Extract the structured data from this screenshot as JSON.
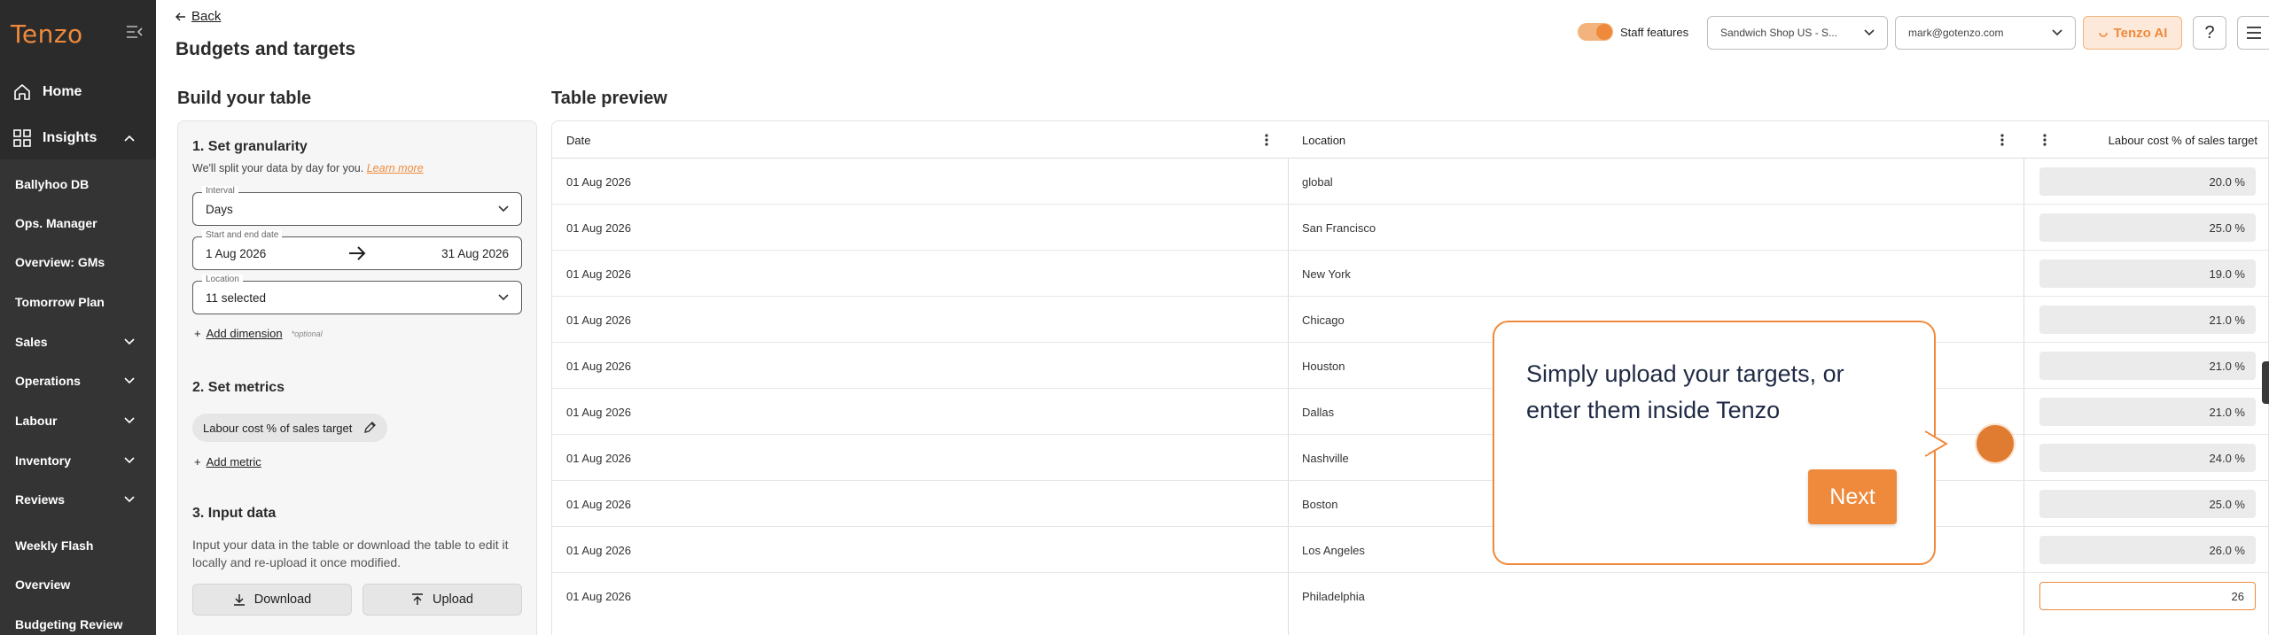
{
  "brand": {
    "logo_text": "Tenzo",
    "accent": "#ef8a3c",
    "sidebar_bg": "#2b2b2b"
  },
  "sidebar": {
    "home": "Home",
    "insights": "Insights",
    "items": [
      {
        "label": "Ballyhoo DB",
        "chevron": false
      },
      {
        "label": "Ops. Manager",
        "chevron": false
      },
      {
        "label": "Overview: GMs",
        "chevron": false
      },
      {
        "label": "Tomorrow Plan",
        "chevron": false
      },
      {
        "label": "Sales",
        "chevron": true
      },
      {
        "label": "Operations",
        "chevron": true
      },
      {
        "label": "Labour",
        "chevron": true
      },
      {
        "label": "Inventory",
        "chevron": true
      },
      {
        "label": "Reviews",
        "chevron": true
      },
      {
        "label": "Weekly Flash",
        "chevron": false
      },
      {
        "label": "Overview",
        "chevron": false
      },
      {
        "label": "Budgeting Review",
        "chevron": false
      }
    ]
  },
  "header": {
    "back": "Back",
    "title": "Budgets and targets",
    "staff_features": "Staff features",
    "shop_select": "Sandwich Shop US - S...",
    "email_select": "mark@gotenzo.com",
    "ai_button": "Tenzo AI",
    "help": "?"
  },
  "build": {
    "title": "Build your table",
    "step1": "1. Set granularity",
    "step1_sub": "We'll split your data by day for you.",
    "learn_more": "Learn more",
    "interval_legend": "Interval",
    "interval_value": "Days",
    "date_legend": "Start and end date",
    "start_date": "1 Aug 2026",
    "end_date": "31 Aug 2026",
    "location_legend": "Location",
    "location_value": "11 selected",
    "add_dimension": "Add dimension",
    "optional": "*optional",
    "step2": "2. Set metrics",
    "metric_chip": "Labour cost % of sales target",
    "add_metric": "Add metric",
    "step3": "3. Input data",
    "step3_desc": "Input your data in the table or download the table to edit it locally and re-upload it once modified.",
    "download": "Download",
    "upload": "Upload"
  },
  "preview": {
    "title": "Table preview",
    "columns": {
      "date": "Date",
      "location": "Location",
      "target": "Labour cost % of sales target"
    },
    "rows": [
      {
        "date": "01 Aug 2026",
        "location": "global",
        "value": "20.0 %"
      },
      {
        "date": "01 Aug 2026",
        "location": "San Francisco",
        "value": "25.0 %"
      },
      {
        "date": "01 Aug 2026",
        "location": "New York",
        "value": "19.0 %"
      },
      {
        "date": "01 Aug 2026",
        "location": "Chicago",
        "value": "21.0 %"
      },
      {
        "date": "01 Aug 2026",
        "location": "Houston",
        "value": "21.0 %"
      },
      {
        "date": "01 Aug 2026",
        "location": "Dallas",
        "value": "21.0 %"
      },
      {
        "date": "01 Aug 2026",
        "location": "Nashville",
        "value": "24.0 %"
      },
      {
        "date": "01 Aug 2026",
        "location": "Boston",
        "value": "25.0 %"
      },
      {
        "date": "01 Aug 2026",
        "location": "Los Angeles",
        "value": "26.0 %"
      },
      {
        "date": "01 Aug 2026",
        "location": "Philadelphia",
        "value": "26"
      }
    ]
  },
  "tooltip": {
    "text": "Simply upload your targets, or enter them inside Tenzo",
    "next": "Next"
  }
}
